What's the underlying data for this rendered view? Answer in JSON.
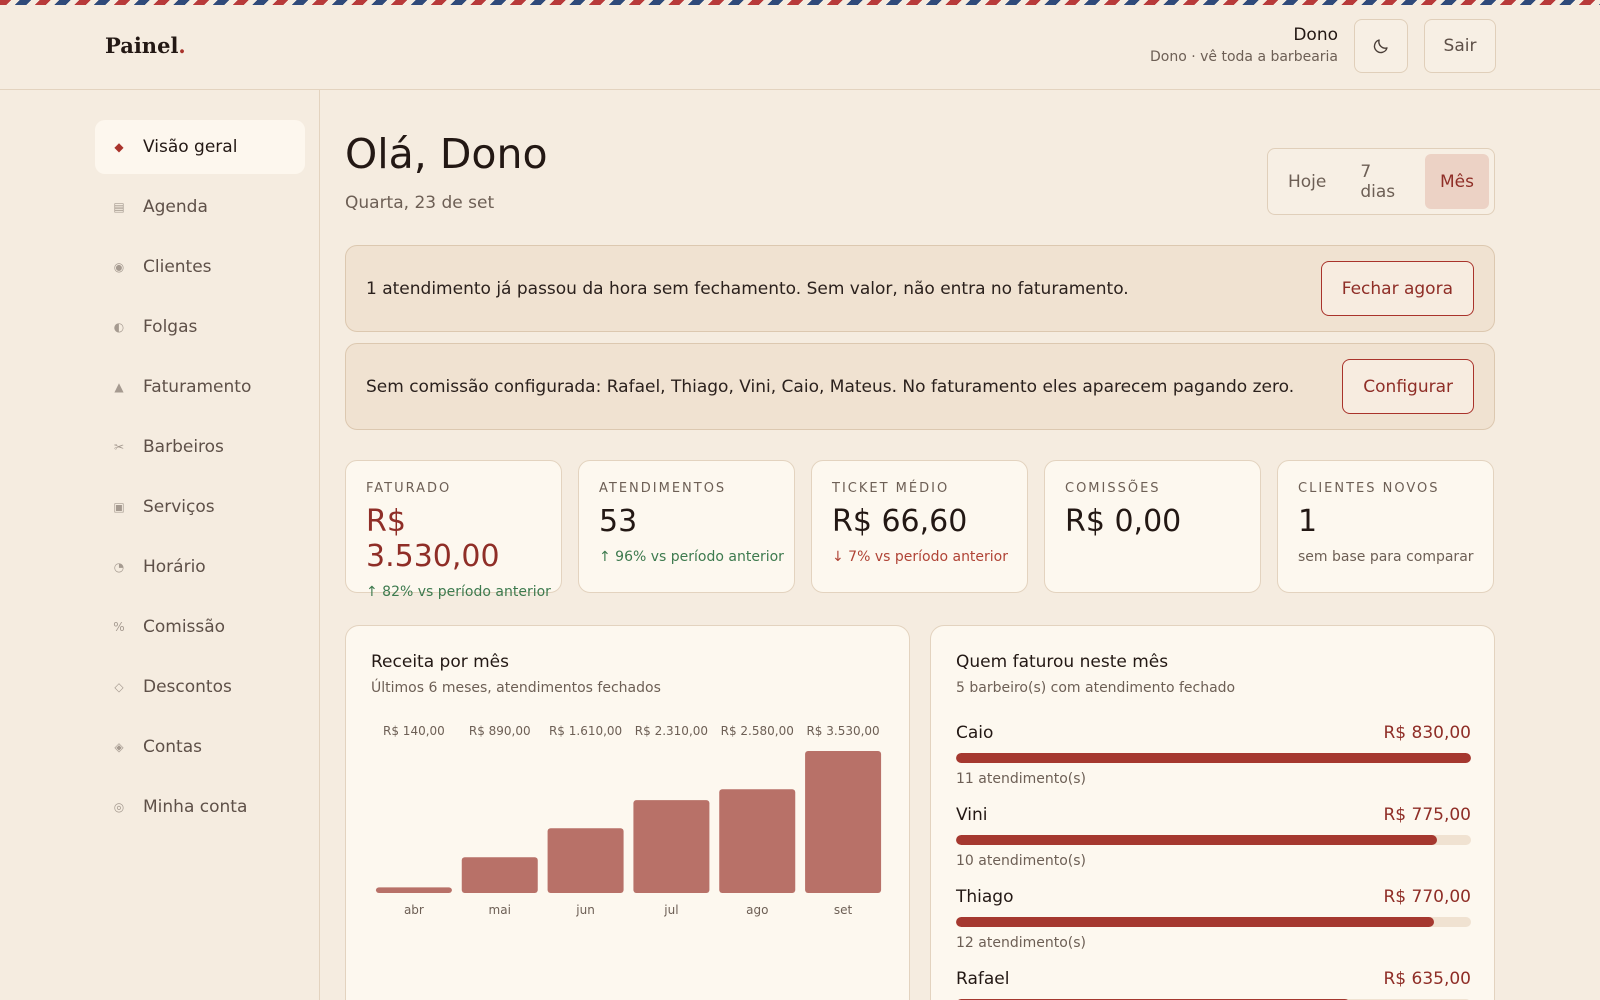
{
  "header": {
    "logo_text": "Painel",
    "logo_dot": ".",
    "user_name": "Dono",
    "user_role": "Dono · vê toda a barbearia",
    "theme_icon": "moon-icon",
    "logout_label": "Sair"
  },
  "sidebar": {
    "items": [
      {
        "label": "Visão geral",
        "icon": "◆",
        "active": true
      },
      {
        "label": "Agenda",
        "icon": "▤",
        "active": false
      },
      {
        "label": "Clientes",
        "icon": "◉",
        "active": false
      },
      {
        "label": "Folgas",
        "icon": "◐",
        "active": false
      },
      {
        "label": "Faturamento",
        "icon": "▲",
        "active": false
      },
      {
        "label": "Barbeiros",
        "icon": "✂",
        "active": false
      },
      {
        "label": "Serviços",
        "icon": "▣",
        "active": false
      },
      {
        "label": "Horário",
        "icon": "◔",
        "active": false
      },
      {
        "label": "Comissão",
        "icon": "%",
        "active": false
      },
      {
        "label": "Descontos",
        "icon": "◇",
        "active": false
      },
      {
        "label": "Contas",
        "icon": "◈",
        "active": false
      },
      {
        "label": "Minha conta",
        "icon": "◎",
        "active": false
      }
    ]
  },
  "main": {
    "greeting": "Olá, Dono",
    "date": "Quarta, 23 de set",
    "period_tabs": [
      "Hoje",
      "7 dias",
      "Mês"
    ],
    "active_period": "Mês",
    "alerts": [
      {
        "text": "1 atendimento já passou da hora sem fechamento. Sem valor, não entra no faturamento.",
        "button": "Fechar agora"
      },
      {
        "text": "Sem comissão configurada: Rafael, Thiago, Vini, Caio, Mateus. No faturamento eles aparecem pagando zero.",
        "button": "Configurar"
      }
    ],
    "stats": [
      {
        "label": "FATURADO",
        "value": "R$ 3.530,00",
        "delta": "↑ 82% vs período anterior",
        "trend": "up",
        "accent": true
      },
      {
        "label": "ATENDIMENTOS",
        "value": "53",
        "delta": "↑ 96% vs período anterior",
        "trend": "up",
        "accent": false
      },
      {
        "label": "TICKET MÉDIO",
        "value": "R$ 66,60",
        "delta": "↓ 7% vs período anterior",
        "trend": "down",
        "accent": false
      },
      {
        "label": "COMISSÕES",
        "value": "R$ 0,00",
        "delta": "",
        "trend": "none",
        "accent": false
      },
      {
        "label": "CLIENTES NOVOS",
        "value": "1",
        "delta": "sem base para comparar",
        "trend": "none",
        "accent": false
      }
    ],
    "revenue_panel": {
      "title": "Receita por mês",
      "subtitle": "Últimos 6 meses, atendimentos fechados"
    },
    "barbers_panel": {
      "title": "Quem faturou neste mês",
      "subtitle": "5 barbeiro(s) com atendimento fechado",
      "rows": [
        {
          "name": "Caio",
          "amount": "R$ 830,00",
          "value": 830,
          "count": "11 atendimento(s)"
        },
        {
          "name": "Vini",
          "amount": "R$ 775,00",
          "value": 775,
          "count": "10 atendimento(s)"
        },
        {
          "name": "Thiago",
          "amount": "R$ 770,00",
          "value": 770,
          "count": "12 atendimento(s)"
        },
        {
          "name": "Rafael",
          "amount": "R$ 635,00",
          "value": 635,
          "count": ""
        }
      ]
    }
  },
  "colors": {
    "accent": "#a9332b",
    "bar": "#b87168",
    "background": "#f5ece0"
  },
  "chart_data": {
    "type": "bar",
    "categories": [
      "abr",
      "mai",
      "jun",
      "jul",
      "ago",
      "set"
    ],
    "values": [
      140,
      890,
      1610,
      2310,
      2580,
      3530
    ],
    "value_labels": [
      "R$ 140,00",
      "R$ 890,00",
      "R$ 1.610,00",
      "R$ 2.310,00",
      "R$ 2.580,00",
      "R$ 3.530,00"
    ],
    "title": "Receita por mês",
    "subtitle": "Últimos 6 meses, atendimentos fechados",
    "xlabel": "",
    "ylabel": "",
    "ylim": [
      0,
      3530
    ],
    "grid": false,
    "legend": "none"
  }
}
